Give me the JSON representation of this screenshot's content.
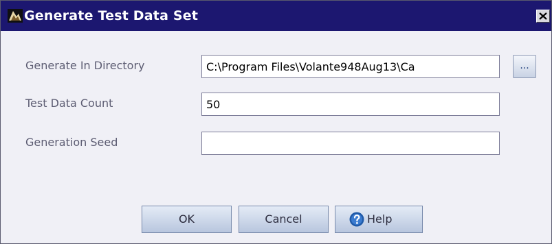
{
  "window": {
    "title": "Generate Test Data Set",
    "icon": "app-icon",
    "close_icon": "close-icon"
  },
  "form": {
    "directory": {
      "label": "Generate In Directory",
      "value": "C:\\Program Files\\Volante948Aug13\\Ca",
      "browse_label": "..."
    },
    "count": {
      "label": "Test Data Count",
      "value": "50"
    },
    "seed": {
      "label": "Generation Seed",
      "value": ""
    }
  },
  "buttons": {
    "ok": "OK",
    "cancel": "Cancel",
    "help": "Help",
    "help_icon": "help-icon"
  },
  "colors": {
    "titlebar": "#1c1770",
    "dialog_background": "#f0f0f6",
    "label_text": "#5c5c72",
    "button_face": "#c8d4e8",
    "help_icon": "#1f5aa8"
  }
}
